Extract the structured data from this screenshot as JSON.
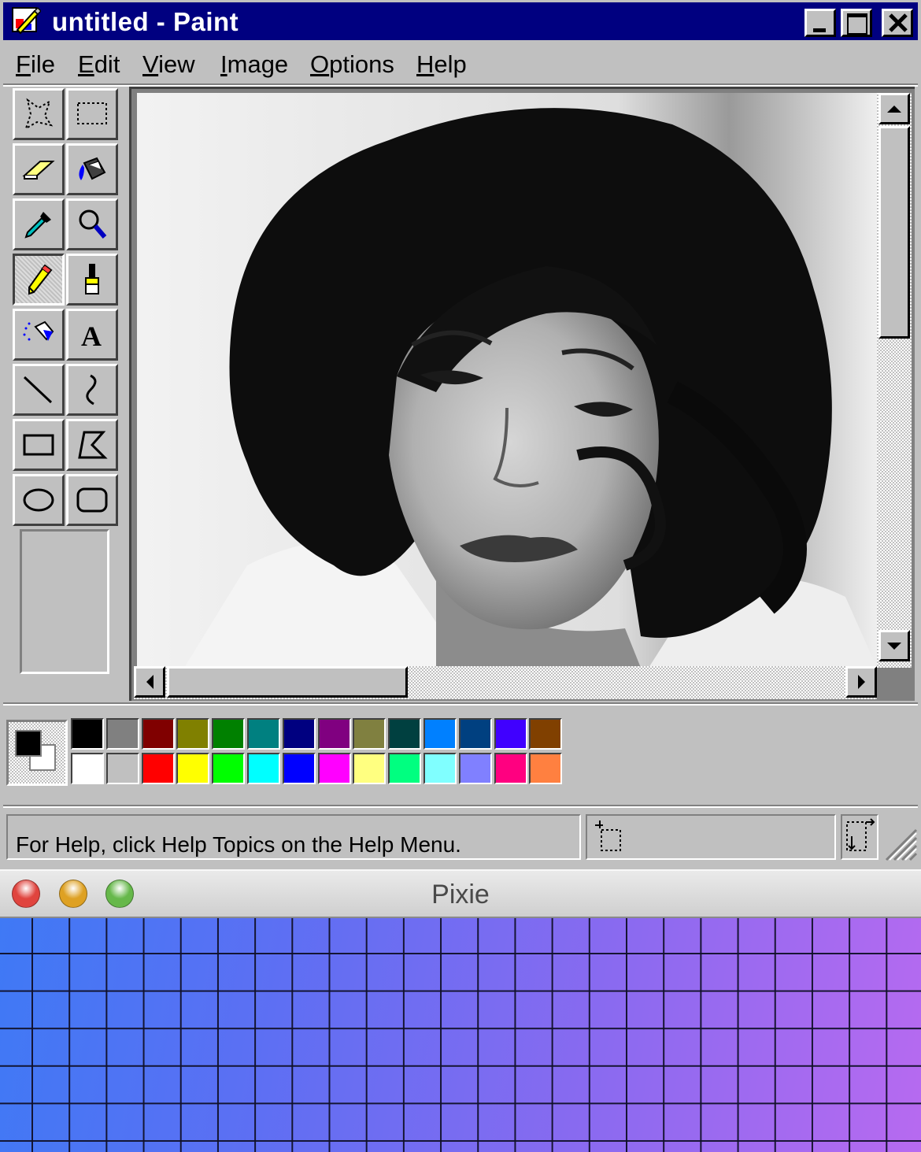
{
  "paint": {
    "title": "untitled - Paint",
    "menu": [
      {
        "accel": "F",
        "rest": "ile"
      },
      {
        "accel": "E",
        "rest": "dit"
      },
      {
        "accel": "V",
        "rest": "iew"
      },
      {
        "accel": "I",
        "rest": "mage"
      },
      {
        "accel": "O",
        "rest": "ptions"
      },
      {
        "accel": "H",
        "rest": "elp"
      }
    ],
    "tools": [
      "free-form-select-icon",
      "rectangle-select-icon",
      "eraser-icon",
      "fill-bucket-icon",
      "color-picker-icon",
      "magnifier-icon",
      "pencil-icon",
      "brush-icon",
      "airbrush-icon",
      "text-icon",
      "line-icon",
      "curve-icon",
      "rectangle-icon",
      "polygon-icon",
      "ellipse-icon",
      "rounded-rectangle-icon"
    ],
    "selected_tool": "pencil-icon",
    "foreground_color": "#000000",
    "background_color": "#ffffff",
    "palette": {
      "top": [
        "#000000",
        "#808080",
        "#800000",
        "#808000",
        "#008000",
        "#008080",
        "#000080",
        "#800080",
        "#808040",
        "#004040",
        "#0080ff",
        "#004080",
        "#4000ff",
        "#804000"
      ],
      "bottom": [
        "#ffffff",
        "#c0c0c0",
        "#ff0000",
        "#ffff00",
        "#00ff00",
        "#00ffff",
        "#0000ff",
        "#ff00ff",
        "#ffff80",
        "#00ff80",
        "#80ffff",
        "#8080ff",
        "#ff0080",
        "#ff8040"
      ]
    },
    "status": "For Help, click Help Topics on the Help Menu."
  },
  "pixie": {
    "title": "Pixie",
    "traffic_lights": [
      "#e0443e",
      "#dea123",
      "#66b84a"
    ]
  }
}
